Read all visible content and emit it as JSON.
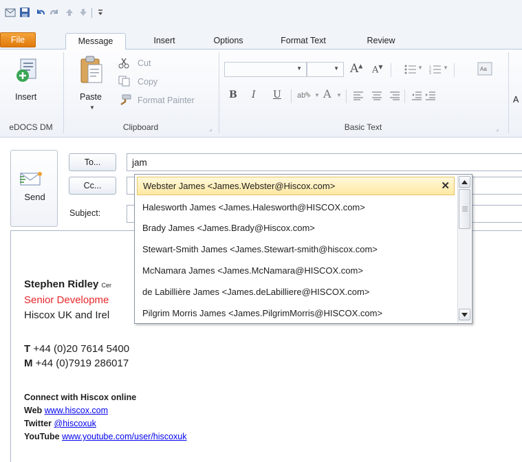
{
  "tabs": [
    "File",
    "Message",
    "Insert",
    "Options",
    "Format Text",
    "Review"
  ],
  "ribbon": {
    "edocs": {
      "insert_label": "Insert",
      "group_label": "eDOCS DM"
    },
    "clipboard": {
      "paste_label": "Paste",
      "cut_label": "Cut",
      "copy_label": "Copy",
      "format_painter_label": "Format Painter",
      "group_label": "Clipboard"
    },
    "basic_text": {
      "group_label": "Basic Text",
      "bold": "B",
      "italic": "I",
      "underline": "U",
      "grow_font": "A",
      "shrink_font": "A",
      "font_color": "A",
      "overflow_label": "A"
    }
  },
  "compose": {
    "send_label": "Send",
    "to_button": "To...",
    "cc_button": "Cc...",
    "subject_label": "Subject:",
    "to_value": "jam"
  },
  "autocomplete": {
    "items": [
      "Webster James <James.Webster@Hiscox.com>",
      "Halesworth James <James.Halesworth@HISCOX.com>",
      "Brady James <James.Brady@Hiscox.com>",
      "Stewart-Smith James <James.Stewart-smith@hiscox.com>",
      "McNamara James <James.McNamara@HISCOX.com>",
      "de Labillière James <James.deLabilliere@HISCOX.com>",
      "Pilgrim Morris James <James.PilgrimMorris@HISCOX.com>"
    ]
  },
  "signature": {
    "name": "Stephen Ridley",
    "name_suffix": "Cer",
    "title": "Senior Developme",
    "company": "Hiscox UK and Irel",
    "phone_t_label": "T",
    "phone_t": "+44 (0)20 7614 5400",
    "phone_m_label": "M",
    "phone_m": "+44 (0)7919 286017",
    "connect_heading": "Connect with Hiscox online",
    "web_label": "Web",
    "web_link": "www.hiscox.com",
    "twitter_label": "Twitter",
    "twitter_link": "@hiscoxuk",
    "youtube_label": "YouTube",
    "youtube_link": "www.youtube.com/user/hiscoxuk"
  },
  "colors": {
    "file_tab": "#e07a0b",
    "title_red": "#e8262a",
    "link_blue": "#0000ee",
    "selection": "#ffe9a3"
  },
  "icons": [
    "save-icon",
    "undo-icon",
    "redo-icon",
    "up-arrow-icon",
    "down-arrow-icon",
    "insert-icon",
    "paste-icon",
    "cut-icon",
    "copy-icon",
    "format-painter-icon",
    "send-icon",
    "close-icon",
    "scroll-up-icon",
    "scroll-down-icon"
  ]
}
